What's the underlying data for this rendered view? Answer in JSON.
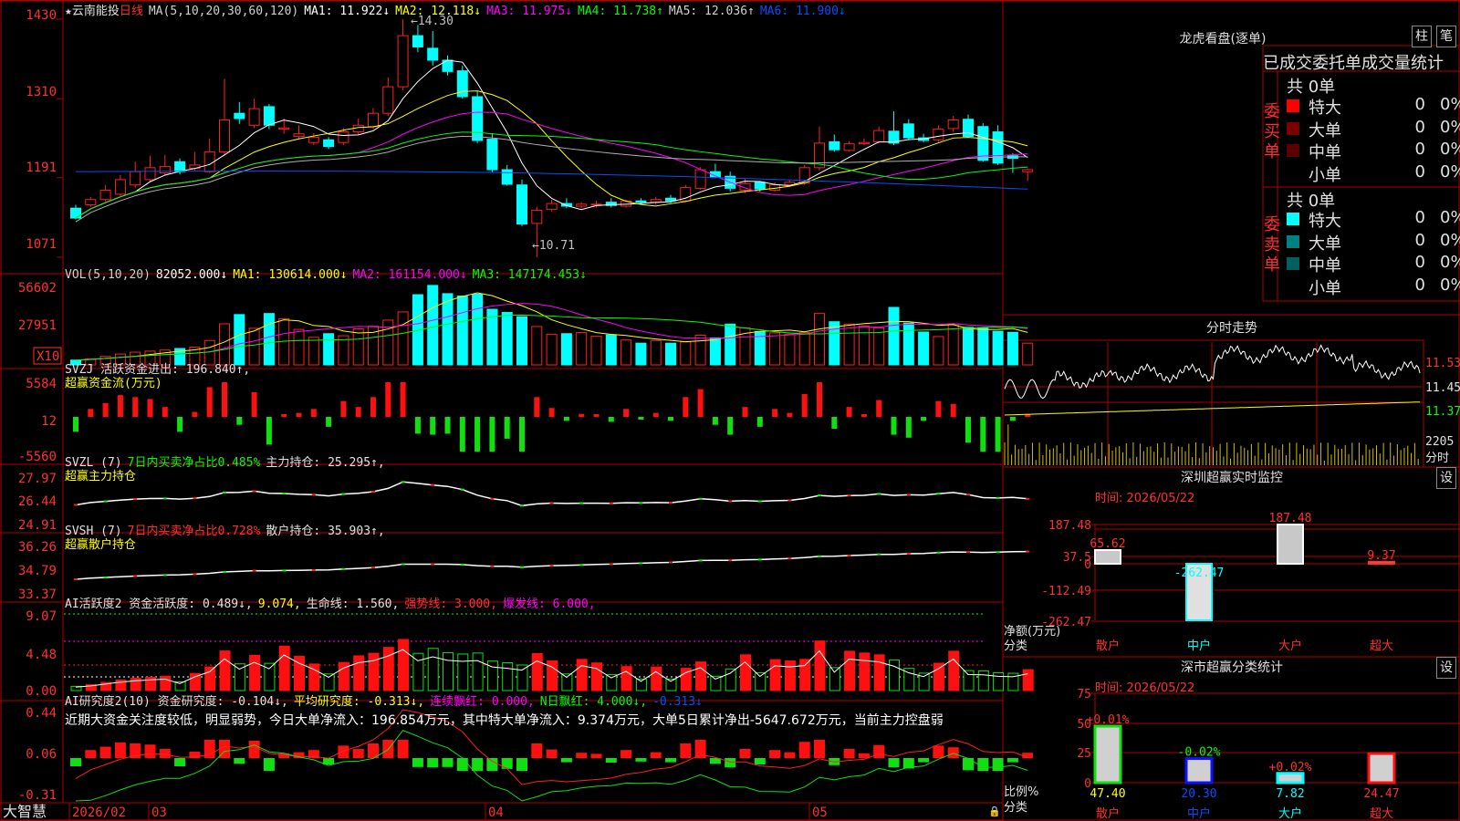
{
  "stock": {
    "name": "云南能投",
    "period": "日线"
  },
  "main_legend": [
    {
      "text": "MA(5,10,20,30,60,120)",
      "color": "#d0d0d0"
    },
    {
      "text": "MA1: 11.922↓",
      "color": "#ffffff"
    },
    {
      "text": "MA2: 12.118↓",
      "color": "#ffff00"
    },
    {
      "text": "MA3: 11.975↓",
      "color": "#ff00ff"
    },
    {
      "text": "MA4: 11.738↑",
      "color": "#00ff00"
    },
    {
      "text": "MA5: 12.036↑",
      "color": "#d0d0d0"
    },
    {
      "text": "MA6: 11.900↓",
      "color": "#0050ff"
    }
  ],
  "price_axis": [
    "1430",
    "1310",
    "1191",
    "1071"
  ],
  "price_annotations": {
    "high": "←14.30",
    "low": "←10.71"
  },
  "volume_legend": [
    {
      "text": "VOL(5,10,20)",
      "color": "#d0d0d0"
    },
    {
      "text": "82052.000↓",
      "color": "#ffffff"
    },
    {
      "text": "MA1: 130614.000↓",
      "color": "#ffff00"
    },
    {
      "text": "MA2: 161154.000↓",
      "color": "#ff00ff"
    },
    {
      "text": "MA3: 147174.453↓",
      "color": "#00ff00"
    }
  ],
  "volume_axis": [
    "56602",
    "27951"
  ],
  "volume_unit": "X10",
  "svzj": {
    "legend": [
      {
        "text": "SVZJ  活跃资金进出: 196.840↑,",
        "color": "#e0e0e0"
      },
      {
        "text": "超赢资金流(万元)",
        "color": "#ffff00"
      }
    ],
    "axis": [
      "5584",
      "12",
      "-5560"
    ]
  },
  "svzl": {
    "legend": [
      {
        "text": "SVZL (7)",
        "color": "#e0e0e0"
      },
      {
        "text": "7日内买卖净占比0.485%",
        "color": "#00ff00"
      },
      {
        "text": "主力持仓: 25.295↑,",
        "color": "#e0e0e0"
      },
      {
        "text": "超赢主力持仓",
        "color": "#ffff00"
      }
    ],
    "axis": [
      "27.97",
      "26.44",
      "24.91"
    ]
  },
  "svsh": {
    "legend": [
      {
        "text": "SVSH (7)",
        "color": "#e0e0e0"
      },
      {
        "text": "7日内买卖净占比0.728%",
        "color": "#ff3030"
      },
      {
        "text": "散户持仓: 35.903↑,",
        "color": "#e0e0e0"
      },
      {
        "text": "超赢散户持仓",
        "color": "#ffff00"
      }
    ],
    "axis": [
      "36.26",
      "34.79",
      "33.37"
    ]
  },
  "ai_active": {
    "legend": [
      {
        "text": "AI活跃度2 资金活跃度: 0.489↓,",
        "color": "#e0e0e0"
      },
      {
        "text": "9.074,",
        "color": "#ffff00"
      },
      {
        "text": "生命线: 1.560,",
        "color": "#e0e0e0"
      },
      {
        "text": "强势线: 3.000,",
        "color": "#ff3030"
      },
      {
        "text": "爆发线: 6.000,",
        "color": "#ff00ff"
      }
    ],
    "axis": [
      "9.07",
      "4.48",
      "0.00"
    ]
  },
  "ai_research": {
    "legend": [
      {
        "text": "AI研究度2(10) 资金研究度: -0.104↓,",
        "color": "#e0e0e0"
      },
      {
        "text": "平均研究度: -0.313↓,",
        "color": "#ffff00"
      },
      {
        "text": "连续飘红: 0.000,",
        "color": "#ff00ff"
      },
      {
        "text": "N日飘红: 4.000↓,",
        "color": "#00ff00"
      },
      {
        "text": "-0.313↓",
        "color": "#0050ff"
      }
    ],
    "comment": "近期大资金关注度较低，明显弱势，今日大单净流入：196.854万元，其中特大单净流入：9.374万元，大单5日累计净出-5647.672万元，当前主力控盘弱",
    "axis": [
      "0.44",
      "0.06",
      "-0.31"
    ]
  },
  "date_axis": {
    "brand": "大智慧",
    "labels": [
      "2026/02",
      "03",
      "04",
      "05"
    ]
  },
  "right": {
    "dragon_title": "龙虎看盘(逐单)",
    "btn_zhu": "柱",
    "btn_bi": "笔",
    "order_header": "已成交委托单成交量统计",
    "buy_label": "委买单",
    "sell_label": "委卖单",
    "buy_total": "共 0单",
    "sell_total": "共 0单",
    "buy_rows": [
      {
        "name": "特大",
        "count": "0",
        "pct": "0%",
        "color": "#ff0000"
      },
      {
        "name": "大单",
        "count": "0",
        "pct": "0%",
        "color": "#7a0000"
      },
      {
        "name": "中单",
        "count": "0",
        "pct": "0%",
        "color": "#5a0000"
      },
      {
        "name": "小单",
        "count": "0",
        "pct": "0%",
        "color": "#000000"
      }
    ],
    "sell_rows": [
      {
        "name": "特大",
        "count": "0",
        "pct": "0%",
        "color": "#00ffff"
      },
      {
        "name": "大单",
        "count": "0",
        "pct": "0%",
        "color": "#008080"
      },
      {
        "name": "中单",
        "count": "0",
        "pct": "0%",
        "color": "#006060"
      },
      {
        "name": "小单",
        "count": "0",
        "pct": "0%",
        "color": "#000000"
      }
    ],
    "intraday_title": "分时走势",
    "intraday_axis": [
      "11.53",
      "11.45",
      "11.37"
    ],
    "intraday_vol_label": "2205",
    "intraday_vol_unit": "分时",
    "sz_title": "深圳超赢实时监控",
    "settings_btn": "设",
    "sz_time": "时间: 2026/05/22",
    "sz_axis": [
      "187.48",
      "37.5",
      "0",
      "-112.49",
      "-262.47"
    ],
    "sz_unit1": "净额(万元)",
    "sz_unit2": "分类",
    "sz_bars": [
      {
        "cat": "散户",
        "value": 65.62,
        "label": "65.62"
      },
      {
        "cat": "中户",
        "value": -262.47,
        "label": "-262.47"
      },
      {
        "cat": "大户",
        "value": 187.48,
        "label": "187.48"
      },
      {
        "cat": "超大",
        "value": 9.37,
        "label": "9.37"
      }
    ],
    "cls_title": "深市超赢分类统计",
    "cls_time": "时间: 2026/05/22",
    "cls_axis": [
      "75",
      "50",
      "25",
      "0"
    ],
    "cls_unit1": "比例%",
    "cls_unit2": "分类",
    "cls_bars": [
      {
        "cat": "散户",
        "value": 47.4,
        "label": "47.40",
        "delta": "+0.01%"
      },
      {
        "cat": "中户",
        "value": 20.3,
        "label": "20.30",
        "delta": "-0.02%"
      },
      {
        "cat": "大户",
        "value": 7.82,
        "label": "7.82",
        "delta": "+0.02%"
      },
      {
        "cat": "超大",
        "value": 24.47,
        "label": "24.47",
        "delta": ""
      }
    ]
  },
  "chart_data": {
    "type": "candlestick",
    "x": [
      "d1",
      "d2",
      "d3",
      "d4",
      "d5",
      "d6",
      "d7",
      "d8",
      "d9",
      "d10",
      "d11",
      "d12",
      "d13",
      "d14",
      "d15",
      "d16",
      "d17",
      "d18",
      "d19",
      "d20",
      "d21",
      "d22",
      "d23",
      "d24",
      "d25",
      "d26",
      "d27",
      "d28",
      "d29",
      "d30",
      "d31",
      "d32",
      "d33",
      "d34",
      "d35",
      "d36",
      "d37",
      "d38",
      "d39",
      "d40",
      "d41",
      "d42",
      "d43",
      "d44",
      "d45",
      "d46",
      "d47",
      "d48",
      "d49",
      "d50",
      "d51",
      "d52",
      "d53",
      "d54",
      "d55",
      "d56",
      "d57",
      "d58",
      "d59",
      "d60",
      "d61",
      "d62",
      "d63",
      "d64",
      "d65"
    ],
    "open": [
      11.45,
      11.5,
      11.58,
      11.66,
      11.8,
      11.88,
      11.98,
      12.15,
      12.05,
      12.0,
      12.3,
      12.88,
      12.7,
      12.98,
      12.64,
      12.53,
      12.44,
      12.48,
      12.44,
      12.6,
      12.68,
      12.88,
      13.28,
      14.05,
      13.86,
      13.68,
      13.52,
      13.13,
      12.49,
      12.03,
      11.8,
      11.22,
      11.43,
      11.52,
      11.48,
      11.5,
      11.54,
      11.48,
      11.56,
      11.54,
      11.6,
      11.56,
      11.75,
      12.0,
      11.93,
      11.72,
      11.84,
      11.72,
      11.8,
      11.83,
      12.06,
      12.45,
      12.32,
      12.42,
      12.45,
      12.61,
      12.72,
      12.51,
      12.48,
      12.65,
      12.79,
      12.68,
      12.6,
      12.24,
      12.0
    ],
    "close": [
      11.3,
      11.58,
      11.72,
      11.88,
      12.0,
      12.06,
      12.08,
      12.0,
      12.1,
      12.3,
      12.78,
      12.8,
      12.95,
      12.7,
      12.66,
      12.57,
      12.52,
      12.38,
      12.6,
      12.7,
      12.88,
      13.28,
      14.05,
      13.88,
      13.68,
      13.51,
      13.13,
      12.47,
      12.03,
      11.81,
      11.21,
      11.42,
      11.52,
      11.48,
      11.51,
      11.51,
      11.49,
      11.56,
      11.54,
      11.58,
      11.56,
      11.76,
      12.03,
      11.92,
      11.75,
      11.82,
      11.74,
      11.8,
      11.84,
      12.06,
      12.43,
      12.33,
      12.42,
      12.44,
      12.62,
      12.43,
      12.51,
      12.47,
      12.64,
      12.78,
      12.53,
      12.17,
      12.13,
      12.2,
      12.03
    ],
    "high": [
      11.5,
      11.62,
      11.8,
      11.95,
      12.15,
      12.24,
      12.25,
      12.2,
      12.3,
      12.5,
      13.4,
      13.05,
      13.1,
      13.02,
      12.8,
      12.7,
      12.58,
      12.52,
      12.66,
      12.8,
      12.96,
      13.42,
      14.3,
      14.21,
      14.12,
      13.75,
      13.6,
      13.21,
      12.58,
      12.1,
      11.88,
      11.47,
      11.58,
      11.6,
      11.54,
      11.56,
      11.6,
      11.58,
      11.6,
      11.62,
      11.65,
      11.8,
      12.07,
      12.12,
      12.0,
      11.9,
      11.86,
      11.84,
      11.87,
      12.1,
      12.68,
      12.56,
      12.46,
      12.5,
      12.68,
      12.91,
      12.79,
      12.57,
      12.7,
      12.84,
      12.86,
      12.73,
      12.7,
      12.28,
      12.05
    ],
    "low": [
      11.28,
      11.47,
      11.55,
      11.63,
      11.76,
      11.85,
      11.94,
      11.96,
      12.01,
      11.98,
      12.24,
      12.72,
      12.66,
      12.64,
      12.57,
      12.49,
      12.4,
      12.34,
      12.4,
      12.55,
      12.64,
      12.84,
      13.23,
      13.8,
      13.6,
      13.45,
      13.1,
      12.43,
      11.99,
      11.79,
      11.18,
      10.71,
      11.4,
      11.45,
      11.45,
      11.46,
      11.46,
      11.46,
      11.5,
      11.5,
      11.53,
      11.54,
      11.73,
      11.9,
      11.7,
      11.68,
      11.7,
      11.7,
      11.77,
      11.8,
      12.02,
      12.3,
      12.3,
      12.4,
      12.43,
      12.4,
      12.49,
      12.44,
      12.45,
      12.6,
      12.52,
      12.15,
      12.1,
      11.98,
      11.86
    ],
    "volume": [
      1800,
      2300,
      3200,
      4100,
      4800,
      5200,
      5600,
      6200,
      6700,
      9200,
      15500,
      19000,
      13800,
      19400,
      17400,
      13400,
      10400,
      11800,
      11000,
      13600,
      14600,
      16900,
      20000,
      26500,
      30000,
      26900,
      26000,
      26700,
      21000,
      19800,
      18200,
      14500,
      11600,
      11800,
      12200,
      10800,
      11300,
      9400,
      8200,
      9200,
      8200,
      8700,
      11200,
      10200,
      15400,
      14000,
      12600,
      12100,
      11600,
      12200,
      19400,
      16300,
      15400,
      14700,
      14000,
      21700,
      15800,
      12400,
      10700,
      15400,
      14200,
      14000,
      12700,
      12300,
      8200
    ]
  }
}
